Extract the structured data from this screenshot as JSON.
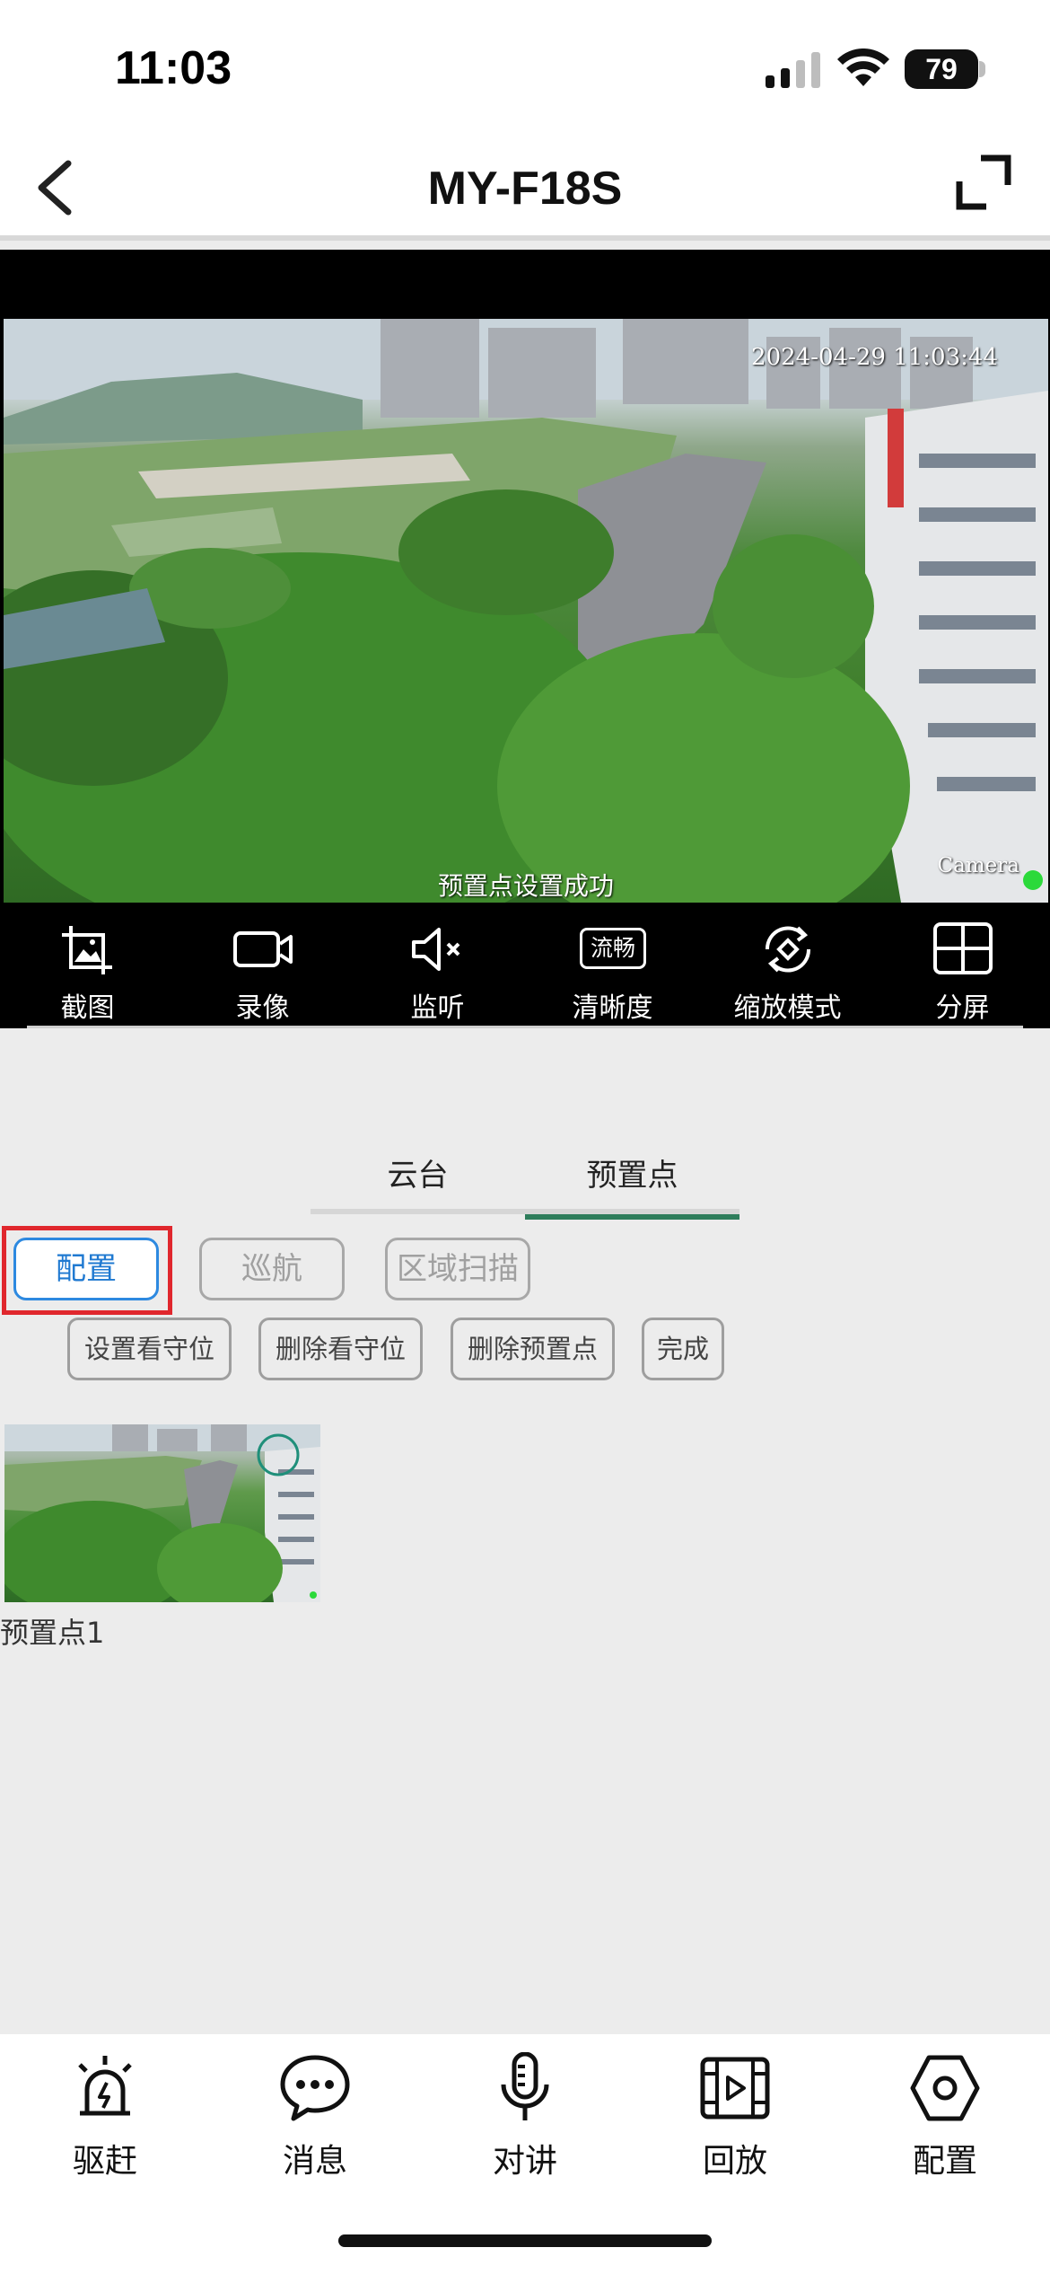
{
  "status_bar": {
    "time": "11:03",
    "battery": "79"
  },
  "nav": {
    "title": "MY-F18S"
  },
  "video": {
    "timestamp": "2024-04-29  11:03:44",
    "toast": "预置点设置成功",
    "camera_label": "Camera"
  },
  "controls": [
    {
      "label": "截图",
      "icon": "screenshot-icon"
    },
    {
      "label": "录像",
      "icon": "record-icon"
    },
    {
      "label": "监听",
      "icon": "speaker-muted-icon"
    },
    {
      "label": "清晰度",
      "icon": "quality-icon",
      "badge": "流畅"
    },
    {
      "label": "缩放模式",
      "icon": "zoom-mode-icon"
    },
    {
      "label": "分屏",
      "icon": "split-screen-icon"
    }
  ],
  "tabs": [
    {
      "label": "云台",
      "active": false
    },
    {
      "label": "预置点",
      "active": true
    }
  ],
  "modes": [
    {
      "label": "配置",
      "active": true
    },
    {
      "label": "巡航",
      "active": false
    },
    {
      "label": "区域扫描",
      "active": false
    }
  ],
  "actions": [
    "设置看守位",
    "删除看守位",
    "删除预置点",
    "完成"
  ],
  "presets": [
    {
      "label": "预置点1"
    }
  ],
  "bottom_nav": [
    {
      "label": "驱赶",
      "icon": "alarm-icon"
    },
    {
      "label": "消息",
      "icon": "message-icon"
    },
    {
      "label": "对讲",
      "icon": "microphone-icon"
    },
    {
      "label": "回放",
      "icon": "playback-icon"
    },
    {
      "label": "配置",
      "icon": "settings-hexagon-icon"
    }
  ],
  "colors": {
    "accent_blue": "#2d89e0",
    "tab_underline": "#2e7d5b",
    "highlight_red": "#e0272d",
    "status_dot": "#2bd93a"
  }
}
